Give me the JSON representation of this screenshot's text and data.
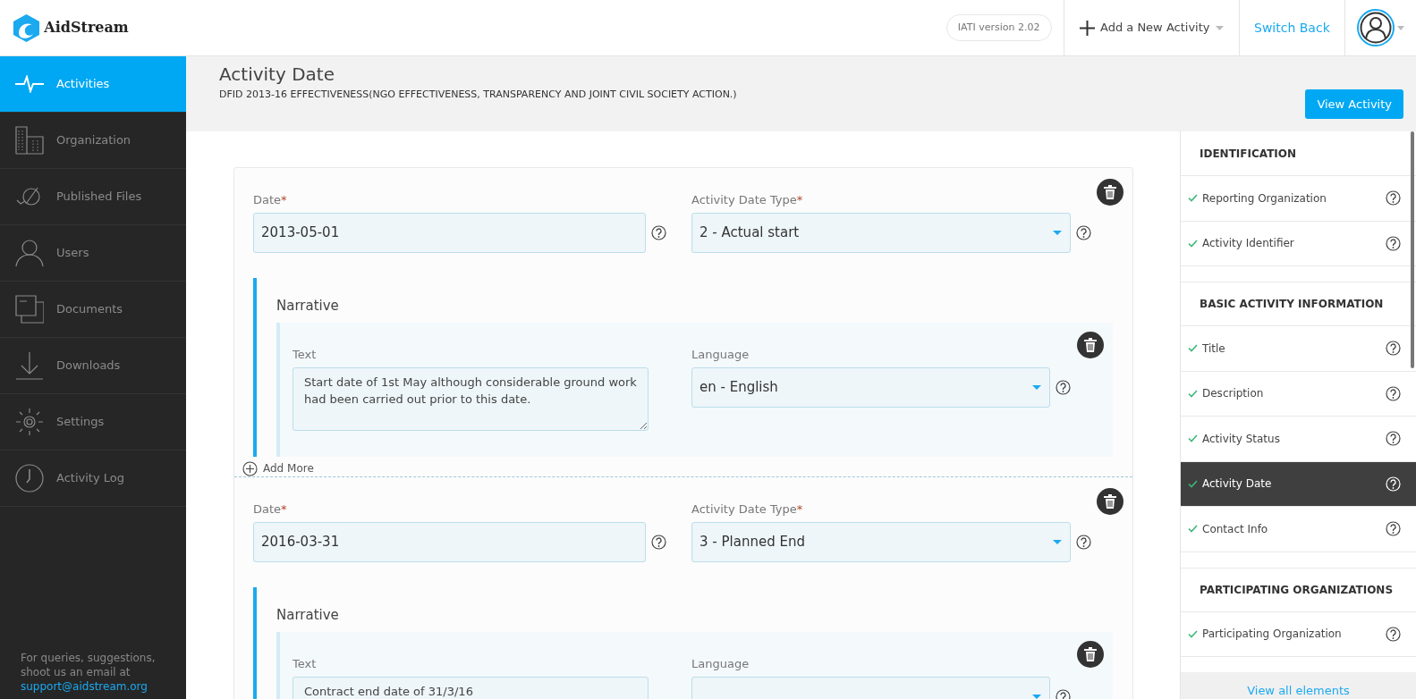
{
  "header": {
    "logo": "AidStream",
    "version": "IATI version 2.02",
    "add_activity": "Add a New Activity",
    "switch_back": "Switch Back"
  },
  "sidebar": {
    "items": [
      {
        "label": "Activities",
        "selected": true
      },
      {
        "label": "Organization",
        "selected": false
      },
      {
        "label": "Published Files",
        "selected": false
      },
      {
        "label": "Users",
        "selected": false
      },
      {
        "label": "Documents",
        "selected": false
      },
      {
        "label": "Downloads",
        "selected": false
      },
      {
        "label": "Settings",
        "selected": false
      },
      {
        "label": "Activity Log",
        "selected": false
      }
    ],
    "footer_text": "For queries, suggestions, shoot us an email at",
    "footer_email": "support@aidstream.org"
  },
  "page": {
    "title": "Activity Date",
    "subtitle": "DFID 2013-16 EFFECTIVENESS(NGO EFFECTIVENESS, TRANSPARENCY AND JOINT CIVIL SOCIETY ACTION.)",
    "view_button": "View Activity"
  },
  "activity_dates": [
    {
      "date_label": "Date",
      "date_required": "*",
      "date": "2013-05-01",
      "type_label": "Activity Date Type",
      "type_required": "*",
      "type": "2 - Actual start",
      "narrative_title": "Narrative",
      "narratives": [
        {
          "text_label": "Text",
          "text": "Start date of 1st May although considerable ground work had been carried out prior to this date.",
          "language_label": "Language",
          "language": "en - English"
        }
      ],
      "add_more": "Add More"
    },
    {
      "date_label": "Date",
      "date_required": "*",
      "date": "2016-03-31",
      "type_label": "Activity Date Type",
      "type_required": "*",
      "type": "3 - Planned End",
      "narrative_title": "Narrative",
      "narratives": [
        {
          "text_label": "Text",
          "text": "Contract end date of 31/3/16",
          "language_label": "Language"
        }
      ]
    }
  ],
  "element_nav": {
    "sections": [
      {
        "title": "IDENTIFICATION",
        "items": [
          {
            "label": "Reporting Organization",
            "completed": true,
            "selected": false
          },
          {
            "label": "Activity Identifier",
            "completed": true,
            "selected": false
          }
        ]
      },
      {
        "title": "BASIC ACTIVITY INFORMATION",
        "items": [
          {
            "label": "Title",
            "completed": true,
            "selected": false
          },
          {
            "label": "Description",
            "completed": true,
            "selected": false
          },
          {
            "label": "Activity Status",
            "completed": true,
            "selected": false
          },
          {
            "label": "Activity Date",
            "completed": true,
            "selected": true
          },
          {
            "label": "Contact Info",
            "completed": true,
            "selected": false
          }
        ]
      },
      {
        "title": "PARTICIPATING ORGANIZATIONS",
        "items": [
          {
            "label": "Participating Organization",
            "completed": true,
            "selected": false
          }
        ]
      }
    ],
    "view_all": "View all elements"
  }
}
